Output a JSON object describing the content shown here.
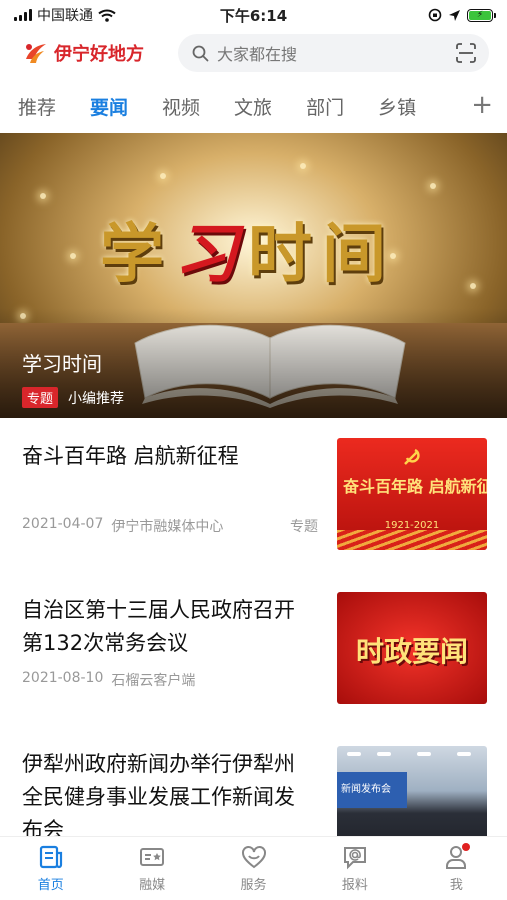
{
  "status_bar": {
    "carrier": "中国联通",
    "time": "下午6:14"
  },
  "header": {
    "logo_text": "伊宁好地方",
    "search_placeholder": "大家都在搜"
  },
  "tabs": [
    "推荐",
    "要闻",
    "视频",
    "文旅",
    "部门",
    "乡镇"
  ],
  "active_tab": 1,
  "banner": {
    "art_text": [
      "学",
      "习",
      "时",
      "间"
    ],
    "title": "学习时间",
    "badge": "专题",
    "source": "小编推荐"
  },
  "news": [
    {
      "title": "奋斗百年路 启航新征程",
      "date": "2021-04-07",
      "source": "伊宁市融媒体中心",
      "tag": "专题",
      "thumb_text": "奋斗百年路 启航新征程",
      "thumb_years": "1921-2021"
    },
    {
      "title": "自治区第十三届人民政府召开第132次常务会议",
      "date": "2021-08-10",
      "source": "石榴云客户端",
      "tag": "",
      "thumb_text": "时政要闻"
    },
    {
      "title": "伊犁州政府新闻办举行伊犁州全民健身事业发展工作新闻发布会",
      "date": "",
      "source": "",
      "tag": "",
      "thumb_text": "新闻发布会"
    }
  ],
  "bottom_nav": [
    {
      "label": "首页",
      "icon": "home-news-icon",
      "active": true
    },
    {
      "label": "融媒",
      "icon": "media-card-icon",
      "active": false
    },
    {
      "label": "服务",
      "icon": "heart-service-icon",
      "active": false
    },
    {
      "label": "报料",
      "icon": "report-chat-icon",
      "active": false
    },
    {
      "label": "我",
      "icon": "user-icon",
      "active": false,
      "notification_dot": true
    }
  ],
  "colors": {
    "accent": "#1a7fe0",
    "brand_red": "#d8262b"
  }
}
